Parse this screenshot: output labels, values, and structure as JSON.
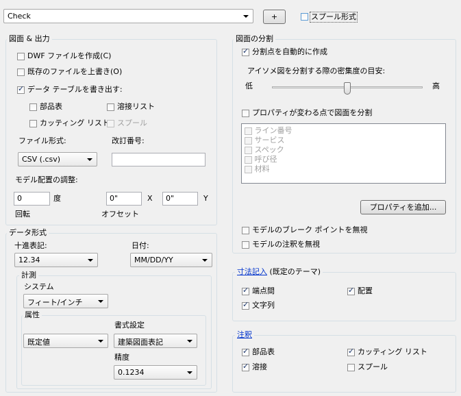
{
  "top": {
    "name_value": "Check",
    "add_label": "+",
    "spool_label": "スプール形式",
    "spool_checked": false
  },
  "drawing_output": {
    "title": "図面 & 出力",
    "dwf_label": "DWF ファイルを作成(C)",
    "dwf_checked": false,
    "overwrite_label": "既存のファイルを上書き(O)",
    "overwrite_checked": false,
    "export_label": "データ テーブルを書き出す:",
    "export_checked": true,
    "bom_label": "部品表",
    "bom_checked": false,
    "weld_label": "溶接リスト",
    "weld_checked": false,
    "cut_label": "カッティング リスト",
    "cut_checked": false,
    "spool_label": "スプール",
    "spool_checked": false,
    "file_format_label": "ファイル形式:",
    "file_format_value": "CSV (.csv)",
    "revision_label": "改訂番号:",
    "revision_value": "",
    "model_adjust_label": "モデル配置の調整:",
    "rotation_value": "0",
    "rotation_unit": "度",
    "offset_x_value": "0\"",
    "x_label": "X",
    "offset_y_value": "0\"",
    "y_label": "Y",
    "rotation_label": "回転",
    "offset_label": "オフセット"
  },
  "data_format": {
    "title": "データ形式",
    "decimal_label": "十進表記:",
    "decimal_value": "12.34",
    "date_label": "日付:",
    "date_value": "MM/DD/YY",
    "measure_title": "計測",
    "system_label": "システム",
    "system_value": "フィート/インチ",
    "attr_title": "属性",
    "attr_value": "既定値",
    "format_label": "書式設定",
    "format_value": "建築図面表記",
    "precision_label": "精度",
    "precision_value": "0.1234"
  },
  "split": {
    "title": "図面の分割",
    "auto_label": "分割点を自動的に作成",
    "auto_checked": true,
    "density_label": "アイソメ図を分割する際の密集度の目安:",
    "low_label": "低",
    "high_label": "高",
    "density_level": 0.5,
    "prop_change_label": "プロパティが変わる点で図面を分割",
    "prop_change_checked": false,
    "props": [
      "ライン番号",
      "サービス",
      "スペック",
      "呼び径",
      "材料"
    ],
    "add_prop_label": "プロパティを追加...",
    "ignore_break_label": "モデルのブレーク ポイントを無視",
    "ignore_break_checked": false,
    "ignore_annot_label": "モデルの注釈を無視",
    "ignore_annot_checked": false
  },
  "dimension": {
    "title_link": "寸法記入",
    "title_suffix": "(既定のテーマ)",
    "endpoints_label": "端点間",
    "endpoints_checked": true,
    "placement_label": "配置",
    "placement_checked": true,
    "string_label": "文字列",
    "string_checked": true
  },
  "annotation": {
    "title_link": "注釈",
    "bom_label": "部品表",
    "bom_checked": true,
    "cut_label": "カッティング リスト",
    "cut_checked": true,
    "weld_label": "溶接",
    "weld_checked": true,
    "spool_label": "スプール",
    "spool_checked": false
  }
}
